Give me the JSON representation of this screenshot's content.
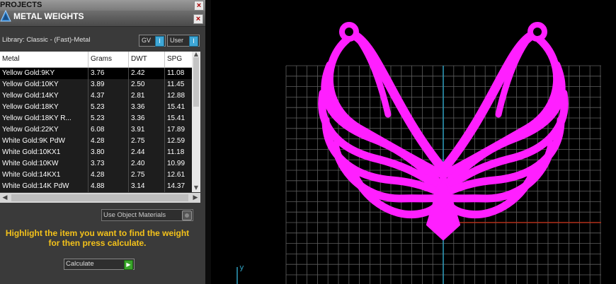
{
  "projects_panel": {
    "title": "PROJECTS",
    "close_label": "×"
  },
  "metal_weights_panel": {
    "title": "METAL WEIGHTS",
    "close_label": "×",
    "library_label": "Library: Classic - (Fast)-Metal",
    "toggles": [
      {
        "label": "GV",
        "knob": "I"
      },
      {
        "label": "User",
        "knob": "I"
      }
    ],
    "table": {
      "columns": [
        "Metal",
        "Grams",
        "DWT",
        "SPG"
      ],
      "rows": [
        [
          "Yellow Gold:9KY",
          "3.76",
          "2.42",
          "11.08"
        ],
        [
          "Yellow Gold:10KY",
          "3.89",
          "2.50",
          "11.45"
        ],
        [
          "Yellow Gold:14KY",
          "4.37",
          "2.81",
          "12.88"
        ],
        [
          "Yellow Gold:18KY",
          "5.23",
          "3.36",
          "15.41"
        ],
        [
          "Yellow Gold:18KY R...",
          "5.23",
          "3.36",
          "15.41"
        ],
        [
          "Yellow Gold:22KY",
          "6.08",
          "3.91",
          "17.89"
        ],
        [
          "White Gold:9K PdW",
          "4.28",
          "2.75",
          "12.59"
        ],
        [
          "White Gold:10KX1",
          "3.80",
          "2.44",
          "11.18"
        ],
        [
          "White Gold:10KW",
          "3.73",
          "2.40",
          "10.99"
        ],
        [
          "White Gold:14KX1",
          "4.28",
          "2.75",
          "12.61"
        ],
        [
          "White Gold:14K PdW",
          "4.88",
          "3.14",
          "14.37"
        ]
      ]
    },
    "use_object_materials_label": "Use Object Materials",
    "hint_text": "Highlight the item you want to find the weight for then press calculate.",
    "calculate_label": "Calculate",
    "colors": {
      "hint": "#f4c21a",
      "toggle_knob": "#3fa7d6",
      "calculate_go": "#39a52a"
    }
  },
  "viewport": {
    "axis_label_y": "y",
    "colors": {
      "grid": "#5f5f5f",
      "y_axis": "#2f9fbf",
      "x_axis": "#b3311a",
      "pendant": "#ff1fff"
    }
  }
}
